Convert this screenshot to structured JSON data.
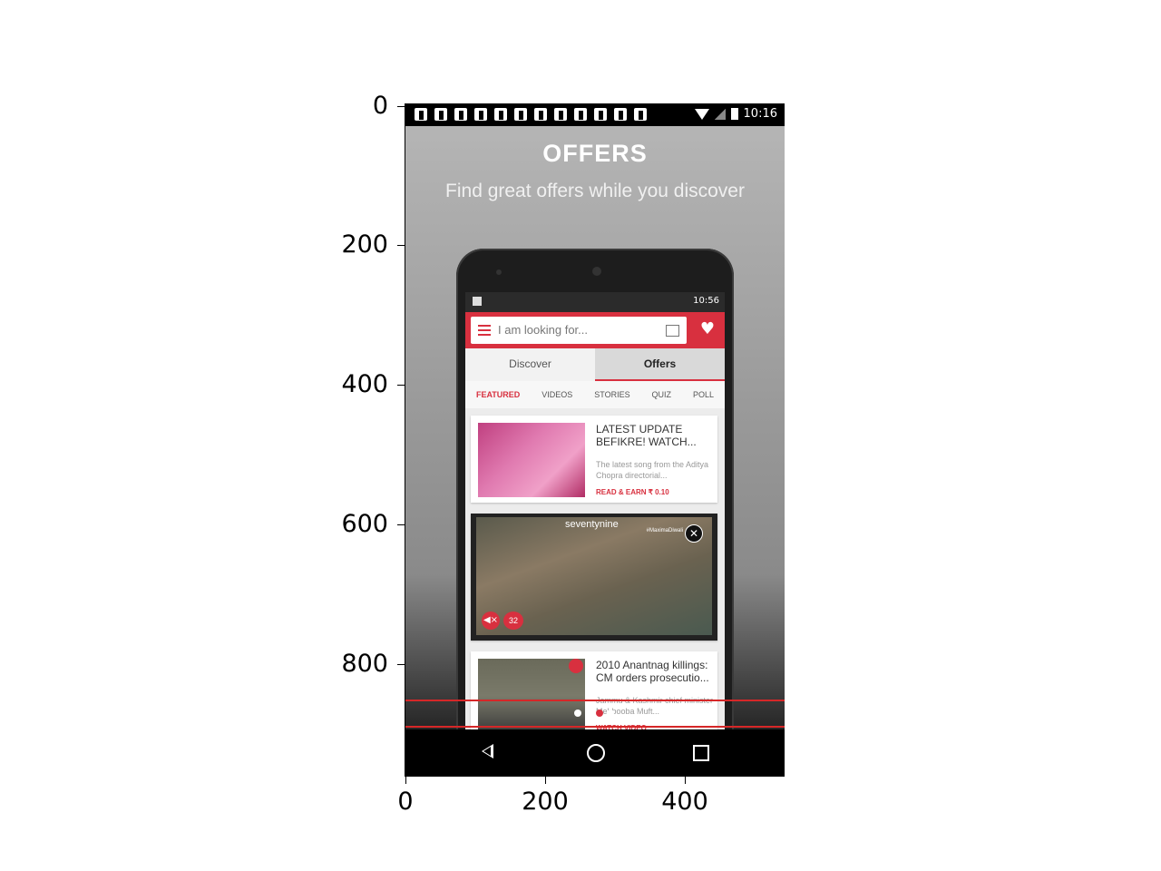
{
  "axes": {
    "yticks": [
      "0",
      "200",
      "400",
      "600",
      "800"
    ],
    "xticks": [
      "0",
      "200",
      "400"
    ]
  },
  "status_bar": {
    "time": "10:16"
  },
  "hero": {
    "title": "OFFERS",
    "subtitle": "Find great offers while you discover"
  },
  "app": {
    "status_time": "10:56",
    "search": {
      "placeholder": "I am looking for..."
    },
    "tabs": [
      {
        "label": "Discover",
        "active": false
      },
      {
        "label": "Offers",
        "active": true
      }
    ],
    "subtabs": [
      {
        "label": "FEATURED",
        "active": true
      },
      {
        "label": "VIDEOS",
        "active": false
      },
      {
        "label": "STORIES",
        "active": false
      },
      {
        "label": "QUIZ",
        "active": false
      },
      {
        "label": "POLL",
        "active": false
      }
    ],
    "cards": [
      {
        "title": "LATEST UPDATE BEFIKRE! WATCH...",
        "desc": "The latest song from the Aditya Chopra directorial...",
        "action": "READ & EARN ₹ 0.10"
      },
      {
        "video_tag": "seventynine",
        "video_tag2": "#MaximaDiwali",
        "count": "32"
      },
      {
        "title": "2010 Anantnag killings: CM orders prosecutio...",
        "desc": "Jammu & Kashmir chief minister Mehbooba Muft...",
        "action": "WATCH VIDEO"
      }
    ]
  },
  "pager": {
    "count": 4,
    "active_index": 2
  },
  "colors": {
    "accent": "#d8303f",
    "hline": "#d62728"
  }
}
